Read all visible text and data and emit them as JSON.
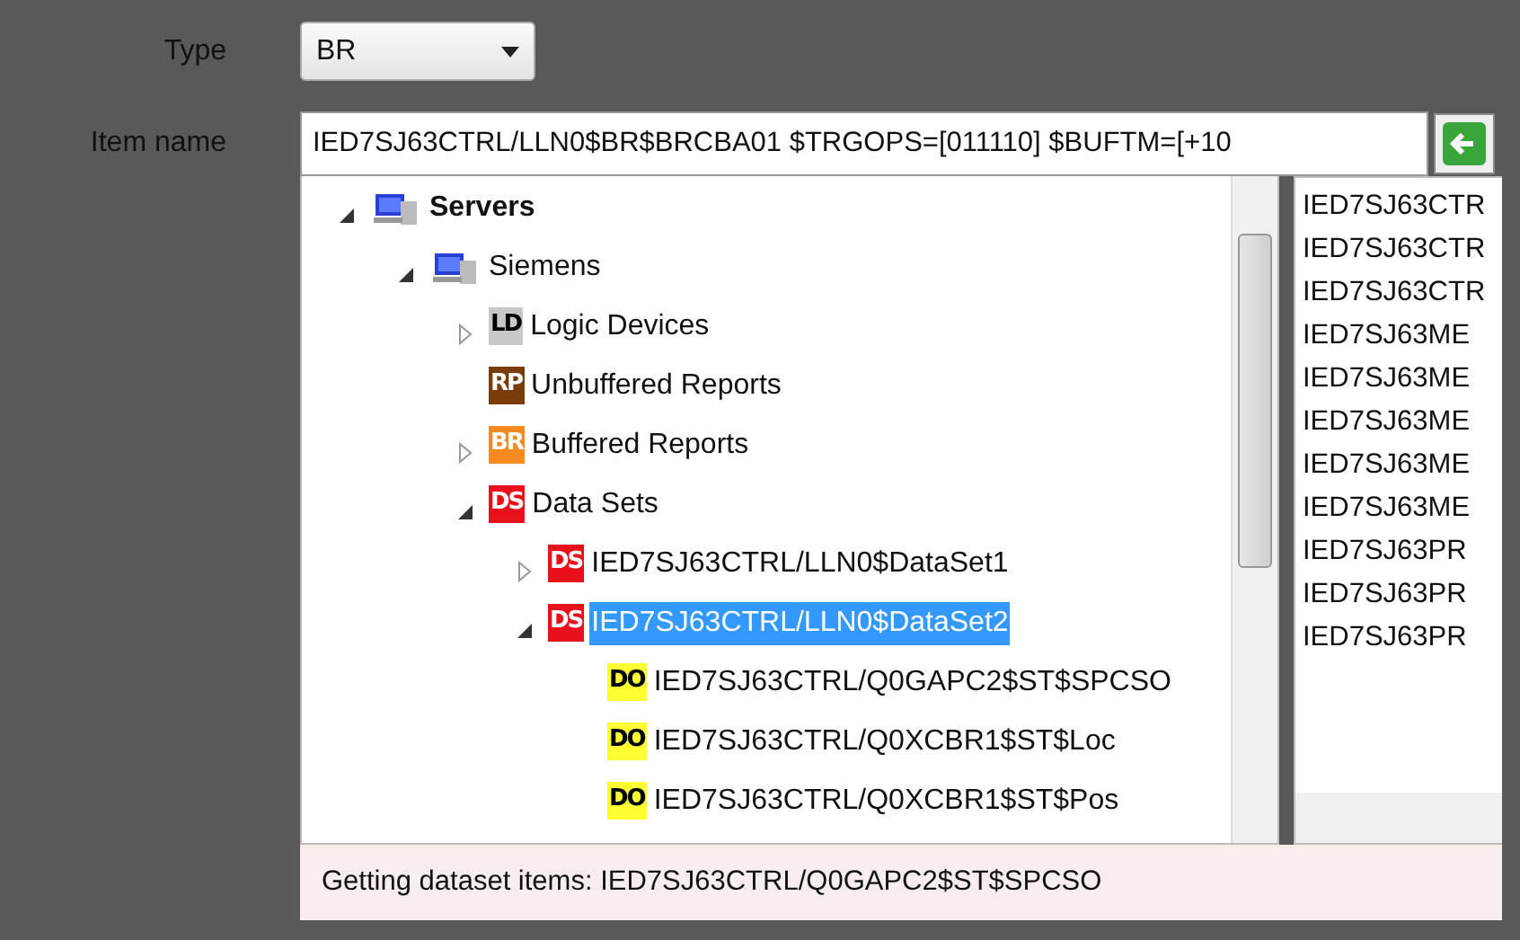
{
  "type_field": {
    "label": "Type",
    "value": "BR"
  },
  "item_name": {
    "label": "Item name",
    "value": "IED7SJ63CTRL/LLN0$BR$BRCBA01 $TRGOPS=[011110] $BUFTM=[+10"
  },
  "tree": [
    {
      "label": "Servers",
      "kind": "server",
      "bold": true,
      "expanded": true,
      "selected": false,
      "children": [
        {
          "label": "Siemens",
          "kind": "server",
          "expanded": true,
          "selected": false,
          "children": [
            {
              "label": "Logic Devices",
              "kind": "ld",
              "badge": "LD",
              "expanded": false,
              "selected": false
            },
            {
              "label": "Unbuffered Reports",
              "kind": "rp",
              "badge": "RP",
              "selected": false
            },
            {
              "label": "Buffered Reports",
              "kind": "br",
              "badge": "BR",
              "expanded": false,
              "selected": false
            },
            {
              "label": "Data Sets",
              "kind": "ds",
              "badge": "DS",
              "expanded": true,
              "selected": false,
              "children": [
                {
                  "label": "IED7SJ63CTRL/LLN0$DataSet1",
                  "kind": "ds",
                  "badge": "DS",
                  "expanded": false,
                  "selected": false
                },
                {
                  "label": "IED7SJ63CTRL/LLN0$DataSet2",
                  "kind": "ds",
                  "badge": "DS",
                  "expanded": true,
                  "selected": true,
                  "children": [
                    {
                      "label": "IED7SJ63CTRL/Q0GAPC2$ST$SPCSO",
                      "kind": "do",
                      "badge": "DO",
                      "selected": false
                    },
                    {
                      "label": "IED7SJ63CTRL/Q0XCBR1$ST$Loc",
                      "kind": "do",
                      "badge": "DO",
                      "selected": false
                    },
                    {
                      "label": "IED7SJ63CTRL/Q0XCBR1$ST$Pos",
                      "kind": "do",
                      "badge": "DO",
                      "selected": false
                    }
                  ]
                }
              ]
            }
          ]
        }
      ]
    }
  ],
  "list": [
    "IED7SJ63CTR",
    "IED7SJ63CTR",
    "IED7SJ63CTR",
    "IED7SJ63ME",
    "IED7SJ63ME",
    "IED7SJ63ME",
    "IED7SJ63ME",
    "IED7SJ63ME",
    "IED7SJ63PR",
    "IED7SJ63PR",
    "IED7SJ63PR"
  ],
  "status_bar": "Getting dataset items: IED7SJ63CTRL/Q0GAPC2$ST$SPCSO"
}
